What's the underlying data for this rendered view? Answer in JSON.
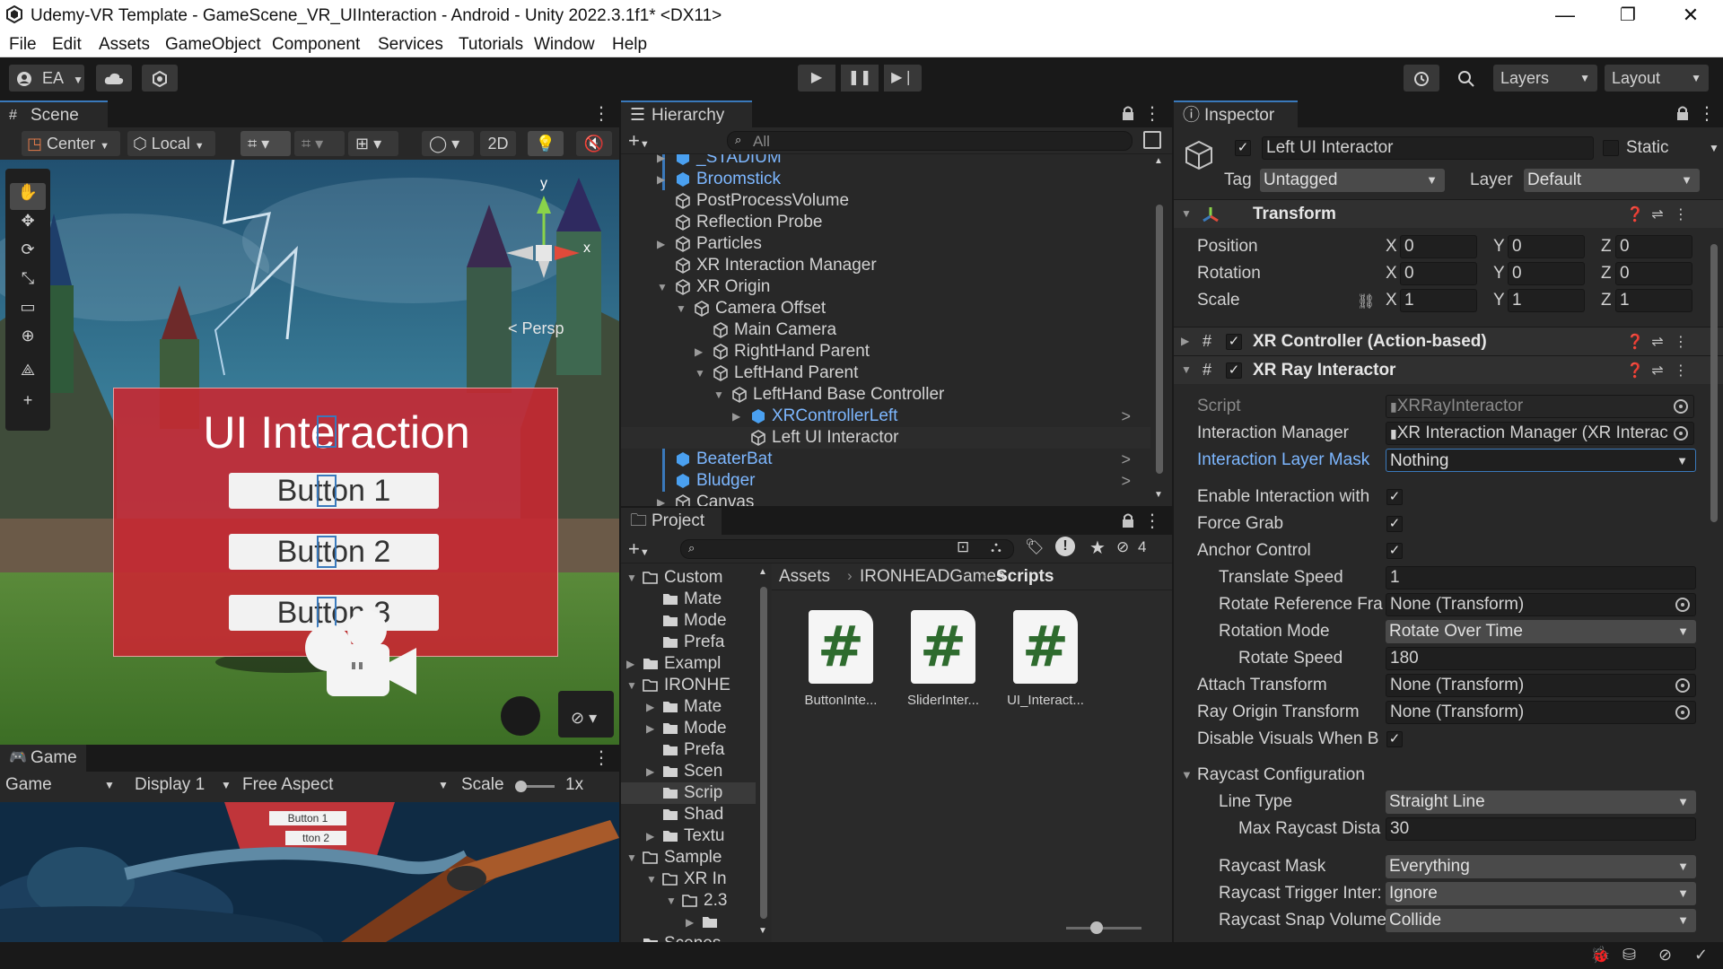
{
  "window": {
    "title": "Udemy-VR Template - GameScene_VR_UIInteraction - Android - Unity 2022.3.1f1* <DX11>",
    "controls": {
      "minimize": "—",
      "maximize": "❐",
      "close": "✕"
    }
  },
  "menu": [
    "File",
    "Edit",
    "Assets",
    "GameObject",
    "Component",
    "Services",
    "Tutorials",
    "Window",
    "Help"
  ],
  "toolbar": {
    "account": "EA",
    "layers": "Layers",
    "layout": "Layout"
  },
  "scene": {
    "tab": "Scene",
    "pivot": "Center",
    "space": "Local",
    "mode2d": "2D",
    "persp": "< Persp",
    "gizmo_y": "y",
    "gizmo_x": "x",
    "ui_title": "UI Interaction",
    "buttons": [
      "Button 1",
      "Button 2",
      "Button 3"
    ]
  },
  "game": {
    "tab": "Game",
    "mode": "Game",
    "display": "Display 1",
    "aspect": "Free Aspect",
    "scale_label": "Scale",
    "scale_value": "1x",
    "buttons": [
      "Button 1",
      "tton 2"
    ]
  },
  "hierarchy": {
    "tab": "Hierarchy",
    "search_placeholder": "All",
    "rows": [
      {
        "label": "_STADIUM",
        "depth": 1,
        "arrow": "▶",
        "prefab": true
      },
      {
        "label": "Broomstick",
        "depth": 1,
        "arrow": "▶",
        "prefab": true
      },
      {
        "label": "PostProcessVolume",
        "depth": 1,
        "arrow": "",
        "prefab": false
      },
      {
        "label": "Reflection Probe",
        "depth": 1,
        "arrow": "",
        "prefab": false
      },
      {
        "label": "Particles",
        "depth": 1,
        "arrow": "▶",
        "prefab": false
      },
      {
        "label": "XR Interaction Manager",
        "depth": 1,
        "arrow": "",
        "prefab": false
      },
      {
        "label": "XR Origin",
        "depth": 1,
        "arrow": "▼",
        "prefab": false
      },
      {
        "label": "Camera Offset",
        "depth": 2,
        "arrow": "▼",
        "prefab": false
      },
      {
        "label": "Main Camera",
        "depth": 3,
        "arrow": "",
        "prefab": false
      },
      {
        "label": "RightHand Parent",
        "depth": 3,
        "arrow": "▶",
        "prefab": false
      },
      {
        "label": "LeftHand Parent",
        "depth": 3,
        "arrow": "▼",
        "prefab": false
      },
      {
        "label": "LeftHand Base Controller",
        "depth": 4,
        "arrow": "▼",
        "prefab": false
      },
      {
        "label": "XRControllerLeft",
        "depth": 5,
        "arrow": "▶",
        "prefab": true,
        "chev": ">"
      },
      {
        "label": "Left UI Interactor",
        "depth": 5,
        "arrow": "",
        "prefab": false,
        "selected": true
      },
      {
        "label": "BeaterBat",
        "depth": 1,
        "arrow": "",
        "prefab": true,
        "chev": ">"
      },
      {
        "label": "Bludger",
        "depth": 1,
        "arrow": "",
        "prefab": true,
        "chev": ">"
      },
      {
        "label": "Canvas",
        "depth": 1,
        "arrow": "▶",
        "prefab": false
      }
    ]
  },
  "project": {
    "tab": "Project",
    "badge": "4",
    "breadcrumb": [
      "Assets",
      "IRONHEADGames",
      "Scripts"
    ],
    "tree": [
      {
        "label": "Custom",
        "depth": 0,
        "arrow": "▼",
        "open": true
      },
      {
        "label": "Mate",
        "depth": 1,
        "arrow": ""
      },
      {
        "label": "Mode",
        "depth": 1,
        "arrow": ""
      },
      {
        "label": "Prefa",
        "depth": 1,
        "arrow": ""
      },
      {
        "label": "Exampl",
        "depth": 0,
        "arrow": "▶"
      },
      {
        "label": "IRONHE",
        "depth": 0,
        "arrow": "▼",
        "open": true
      },
      {
        "label": "Mate",
        "depth": 1,
        "arrow": "▶"
      },
      {
        "label": "Mode",
        "depth": 1,
        "arrow": "▶"
      },
      {
        "label": "Prefa",
        "depth": 1,
        "arrow": ""
      },
      {
        "label": "Scen",
        "depth": 1,
        "arrow": "▶"
      },
      {
        "label": "Scrip",
        "depth": 1,
        "arrow": "",
        "selected": true
      },
      {
        "label": "Shad",
        "depth": 1,
        "arrow": ""
      },
      {
        "label": "Textu",
        "depth": 1,
        "arrow": "▶"
      },
      {
        "label": "Sample",
        "depth": 0,
        "arrow": "▼",
        "open": true
      },
      {
        "label": "XR In",
        "depth": 1,
        "arrow": "▼",
        "open": true
      },
      {
        "label": "2.3",
        "depth": 2,
        "arrow": "▼",
        "open": true
      },
      {
        "label": "",
        "depth": 3,
        "arrow": "▶"
      },
      {
        "label": "Scenes",
        "depth": 0,
        "arrow": ""
      }
    ],
    "assets": [
      {
        "glyph": "#",
        "name": "ButtonInte..."
      },
      {
        "glyph": "#",
        "name": "SliderInter..."
      },
      {
        "glyph": "#",
        "name": "UI_Interact..."
      }
    ],
    "slider_value": 0.4
  },
  "inspector": {
    "tab": "Inspector",
    "object_name": "Left UI Interactor",
    "active_check": "✓",
    "static_label": "Static",
    "tag_label": "Tag",
    "tag_value": "Untagged",
    "layer_label": "Layer",
    "layer_value": "Default",
    "transform": {
      "title": "Transform",
      "rows": [
        {
          "label": "Position",
          "x": "0",
          "y": "0",
          "z": "0"
        },
        {
          "label": "Rotation",
          "x": "0",
          "y": "0",
          "z": "0"
        },
        {
          "label": "Scale",
          "x": "1",
          "y": "1",
          "z": "1"
        }
      ]
    },
    "xr_controller": {
      "title": "XR Controller (Action-based)"
    },
    "xr_ray": {
      "title": "XR Ray Interactor",
      "script_label": "Script",
      "script_value": "XRRayInteractor",
      "interaction_manager_label": "Interaction Manager",
      "interaction_manager_value": "XR Interaction Manager (XR Interac",
      "layer_mask_label": "Interaction Layer Mask",
      "layer_mask_value": "Nothing",
      "enable_interaction_label": "Enable Interaction with",
      "force_grab_label": "Force Grab",
      "anchor_control_label": "Anchor Control",
      "translate_speed_label": "Translate Speed",
      "translate_speed_value": "1",
      "rotate_ref_label": "Rotate Reference Fra",
      "rotate_ref_value": "None (Transform)",
      "rotation_mode_label": "Rotation Mode",
      "rotation_mode_value": "Rotate Over Time",
      "rotate_speed_label": "Rotate Speed",
      "rotate_speed_value": "180",
      "attach_transform_label": "Attach Transform",
      "attach_transform_value": "None (Transform)",
      "ray_origin_label": "Ray Origin Transform",
      "ray_origin_value": "None (Transform)",
      "disable_visuals_label": "Disable Visuals When B",
      "raycast_config_label": "Raycast Configuration",
      "line_type_label": "Line Type",
      "line_type_value": "Straight Line",
      "max_raycast_label": "Max Raycast Dista",
      "max_raycast_value": "30",
      "raycast_mask_label": "Raycast Mask",
      "raycast_mask_value": "Everything",
      "raycast_trigger_label": "Raycast Trigger Inter:",
      "raycast_trigger_value": "Ignore",
      "raycast_snap_label": "Raycast Snap Volume",
      "raycast_snap_value": "Collide"
    }
  },
  "colors": {
    "accent_blue": "#3a79bb",
    "prefab_blue": "#7db7ff",
    "panel_bg": "#282828",
    "script_green": "#2e6b2e"
  }
}
